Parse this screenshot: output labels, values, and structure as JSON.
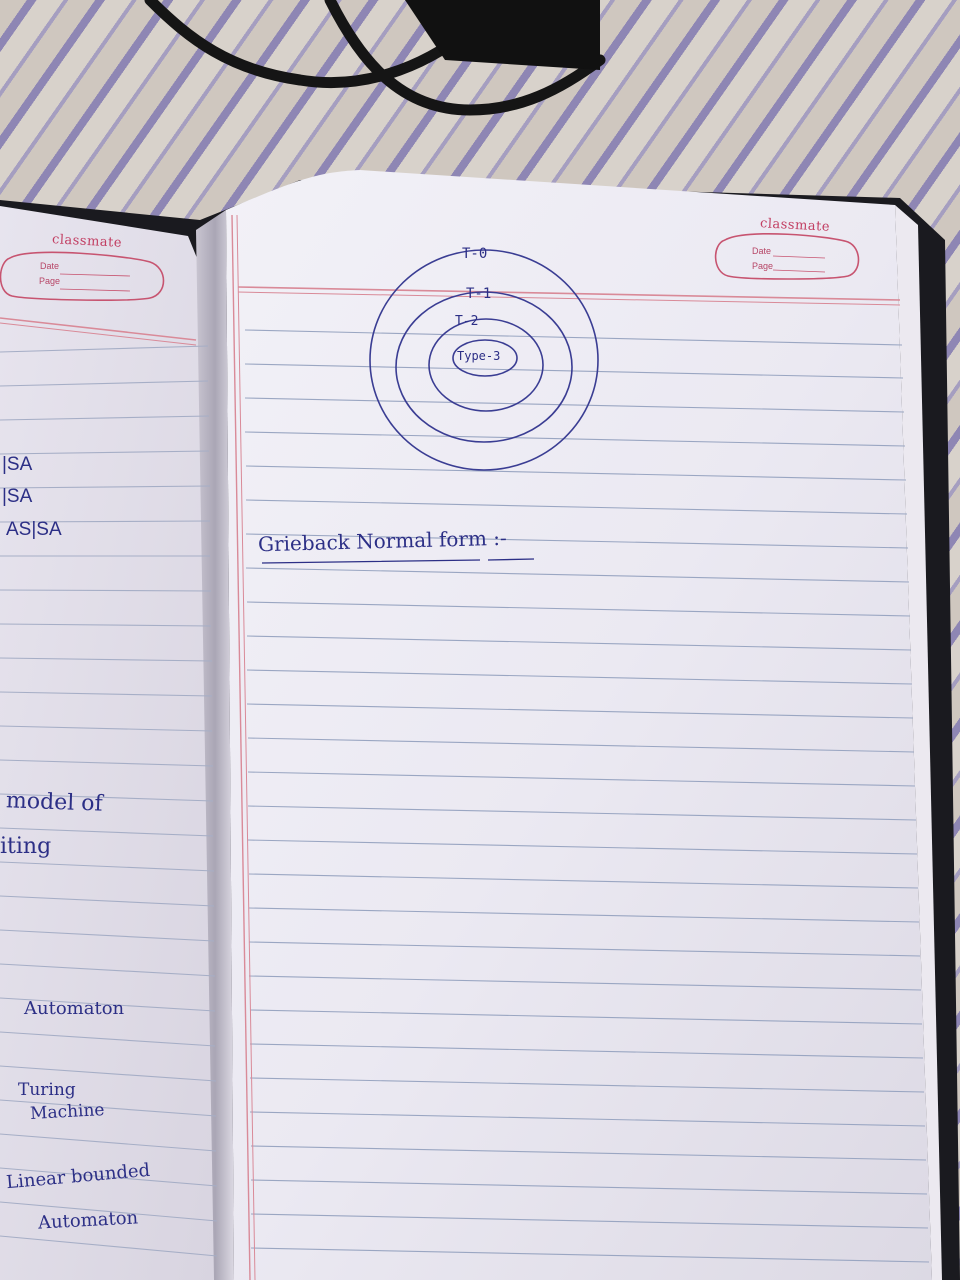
{
  "notebook": {
    "brand_left": "classmate",
    "brand_right": "classmate",
    "date_label": "Date",
    "page_label": "Page"
  },
  "right_page": {
    "diagram_labels": [
      "T-0",
      "T-1",
      "T-2",
      "Type-3"
    ],
    "heading": "Grieback Normal form :-"
  },
  "left_page": {
    "fragments": [
      "|SA",
      "|SA",
      "AS|SA",
      "model of",
      "iting",
      "Automaton",
      "Turing",
      "Machine",
      "Linear bounded",
      "Automaton"
    ]
  },
  "colors": {
    "ink": "#2c2f86",
    "margin_line": "#d98a98",
    "rule_line": "#9aa6c2",
    "brand": "#c23e62"
  }
}
